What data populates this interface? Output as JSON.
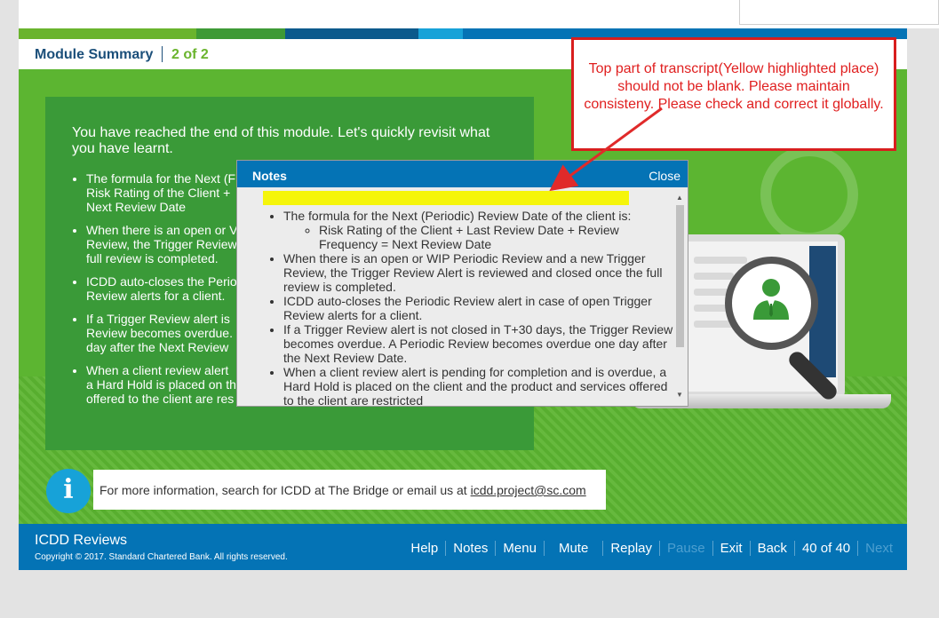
{
  "module_header": {
    "title": "Module Summary",
    "page": "2 of 2"
  },
  "summary": {
    "intro": "You have reached the end of this module. Let's quickly revisit what you have learnt.",
    "bullets": [
      {
        "lines": [
          "The formula for the Next (F",
          "Risk Rating of the Client +",
          "Next Review Date"
        ]
      },
      {
        "lines": [
          "When there is an open or V",
          "Review, the Trigger Review",
          "full review is completed."
        ]
      },
      {
        "lines": [
          "ICDD auto-closes the Perio",
          "Review alerts for a client."
        ]
      },
      {
        "lines": [
          "If a Trigger Review alert is",
          "Review becomes overdue.",
          "day after the Next Review"
        ]
      },
      {
        "lines": [
          "When a client review alert",
          "a Hard Hold is placed on th",
          "offered to the client are res"
        ]
      }
    ]
  },
  "notes": {
    "title": "Notes",
    "close_label": "Close",
    "item1": "The formula for the Next (Periodic) Review Date of the client is:",
    "item1_sub": "Risk Rating of the Client + Last Review Date + Review Frequency = Next Review Date",
    "item2": "When there is an open or WIP Periodic Review and a new Trigger Review, the Trigger Review Alert is reviewed and closed once the full review is completed.",
    "item3": "ICDD auto-closes the Periodic Review alert in case of open Trigger Review alerts for a client.",
    "item4": "If a Trigger Review alert is not closed in T+30 days, the Trigger Review becomes overdue. A Periodic Review becomes overdue one day after the Next Review Date.",
    "item5": "When a client review alert is pending for completion and is overdue, a Hard Hold is placed on the client and the product and services offered to the client are restricted"
  },
  "info": {
    "text": "For more information, search for ICDD at The Bridge or email us at ",
    "email": "icdd.project@sc.com",
    "icon": "info-icon"
  },
  "footer": {
    "title": "ICDD Reviews",
    "copyright": "Copyright © 2017. Standard Chartered Bank. All rights reserved.",
    "nav": {
      "help": "Help",
      "notes": "Notes",
      "menu": "Menu",
      "mute": "Mute",
      "replay": "Replay",
      "pause": "Pause",
      "exit": "Exit",
      "back": "Back",
      "page": "40 of 40",
      "next": "Next"
    }
  },
  "annotation": {
    "text": "Top part of transcript(Yellow highlighted place) should not be blank. Please maintain consisteny. Please check and correct it globally."
  },
  "colors": {
    "brand_blue": "#0473b5",
    "brand_green": "#5cb531",
    "panel_green": "#3a9a38",
    "highlight_yellow": "#f5f50a",
    "annotation_red": "#d81e1e"
  }
}
